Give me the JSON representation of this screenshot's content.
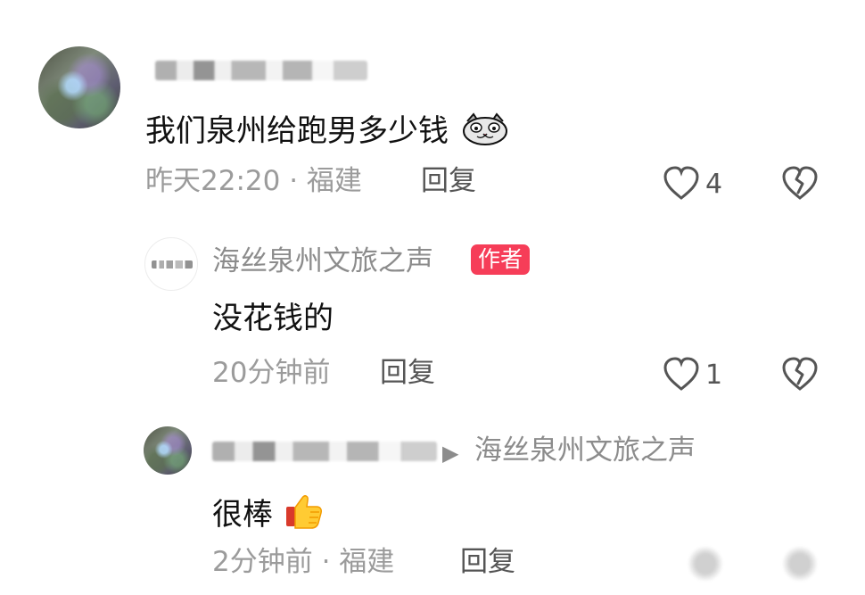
{
  "comments": [
    {
      "content": "我们泉州给跑男多少钱",
      "meta": "昨天22:20 · 福建",
      "reply": "回复",
      "likes": "4"
    },
    {
      "author": "海丝泉州文旅之声",
      "badge": "作者",
      "content": "没花钱的",
      "meta": "20分钟前",
      "reply": "回复",
      "likes": "1"
    },
    {
      "reply_target": "海丝泉州文旅之声",
      "content": "很棒",
      "meta": "2分钟前 · 福建",
      "reply": "回复"
    }
  ],
  "icons": {
    "heart": "heart-icon",
    "dislike": "broken-heart-icon",
    "cat_emoji": "cat-face-icon",
    "thumbs_up": "thumbs-up-icon",
    "reply_arrow": "reply-arrow-icon"
  },
  "colors": {
    "background": "#ffffff",
    "badge": "#f63d58",
    "primary_text": "#111111",
    "secondary_text": "#9b9b9b",
    "action_text": "#555555"
  }
}
